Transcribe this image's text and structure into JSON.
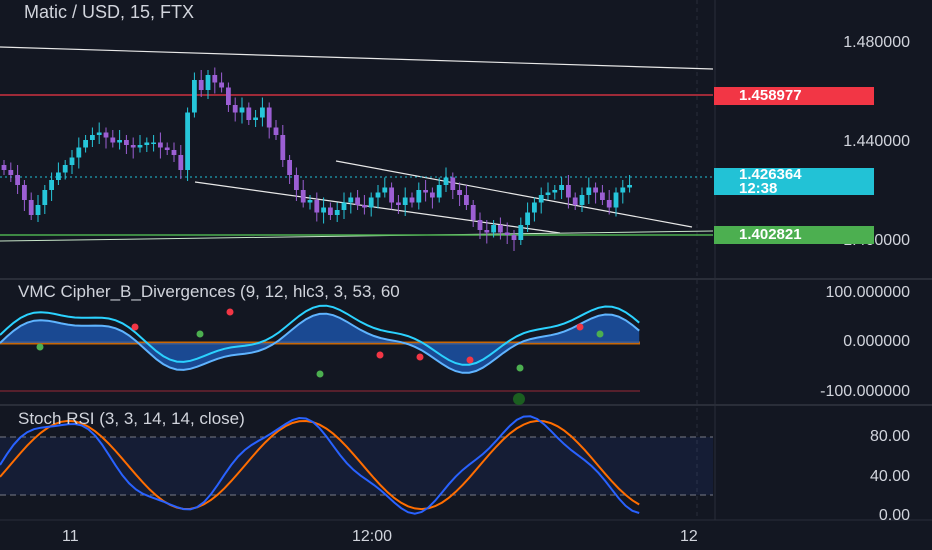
{
  "header": {
    "symbol_title": "Matic / USD, 15, FTX"
  },
  "price_axis": {
    "labels": [
      "1.480000",
      "1.440000",
      "1.400000"
    ],
    "tags": [
      {
        "value": "1.458977",
        "color": "#f23645"
      },
      {
        "value": "1.426364",
        "sub": "12:38",
        "color": "#22c2d6"
      },
      {
        "value": "1.402821",
        "color": "#4caf50"
      }
    ]
  },
  "indicators": {
    "vmc": {
      "label": "VMC Cipher_B_Divergences (9, 12, hlc3, 3, 53, 60",
      "axis": [
        "100.000000",
        "0.000000",
        "-100.000000"
      ]
    },
    "stoch": {
      "label": "Stoch RSI (3, 3, 14, 14, close)",
      "axis": [
        "80.00",
        "40.00",
        "0.00"
      ]
    }
  },
  "time_axis": {
    "labels": [
      "11",
      "12:00",
      "12"
    ]
  },
  "colors": {
    "background": "#131722",
    "up": "#26c6da",
    "down": "#9c5fd4",
    "red_line": "#f23645",
    "green_line": "#4caf50",
    "stoch_k": "#2962ff",
    "stoch_d": "#ff6d00"
  },
  "chart_data": {
    "type": "candlestick",
    "y_range": [
      1.39,
      1.49
    ],
    "close_prices": [
      1.432,
      1.43,
      1.426,
      1.42,
      1.414,
      1.418,
      1.424,
      1.428,
      1.431,
      1.434,
      1.437,
      1.441,
      1.444,
      1.446,
      1.447,
      1.445,
      1.443,
      1.444,
      1.442,
      1.441,
      1.442,
      1.443,
      1.443,
      1.441,
      1.44,
      1.438,
      1.432,
      1.455,
      1.468,
      1.464,
      1.47,
      1.467,
      1.465,
      1.458,
      1.455,
      1.457,
      1.452,
      1.453,
      1.457,
      1.449,
      1.446,
      1.436,
      1.43,
      1.424,
      1.419,
      1.42,
      1.415,
      1.417,
      1.414,
      1.416,
      1.419,
      1.421,
      1.418,
      1.417,
      1.421,
      1.423,
      1.425,
      1.419,
      1.418,
      1.421,
      1.419,
      1.424,
      1.423,
      1.421,
      1.426,
      1.429,
      1.424,
      1.422,
      1.418,
      1.412,
      1.408,
      1.407,
      1.41,
      1.407,
      1.406,
      1.404,
      1.41,
      1.415,
      1.419,
      1.422,
      1.423,
      1.424,
      1.426,
      1.421,
      1.418,
      1.422,
      1.425,
      1.423,
      1.42,
      1.417,
      1.423,
      1.425,
      1.426
    ]
  }
}
